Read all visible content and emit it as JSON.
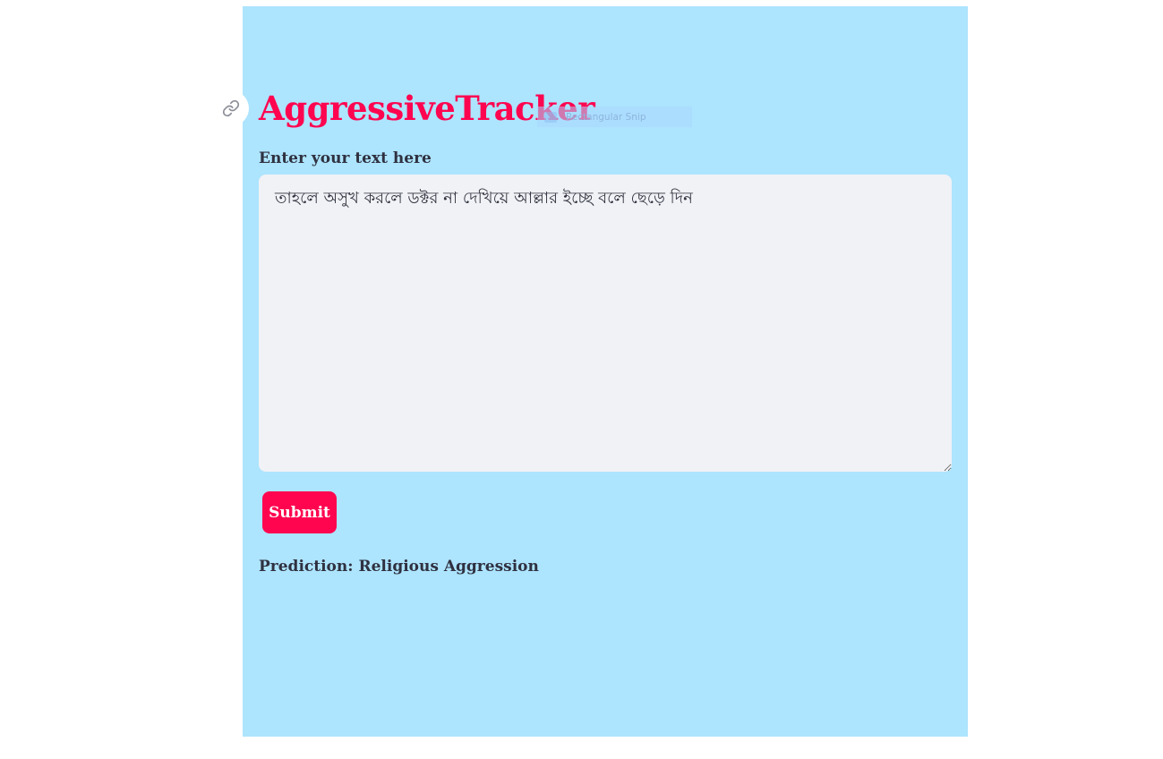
{
  "app": {
    "title": "AggressiveTracker",
    "accent_color": "#ff0550",
    "panel_color": "#ade4fe"
  },
  "icons": {
    "anchor": "link-icon",
    "snip": "snip-icon"
  },
  "snip_overlay": {
    "label": "Rectangular Snip"
  },
  "input": {
    "label": "Enter your text here",
    "value": "তাহলে অসুখ করলে ডক্টর না দেখিয়ে আল্লার ইচ্ছে বলে ছেড়ে দিন"
  },
  "submit": {
    "label": "Submit"
  },
  "result": {
    "text": "Prediction: Religious Aggression"
  }
}
